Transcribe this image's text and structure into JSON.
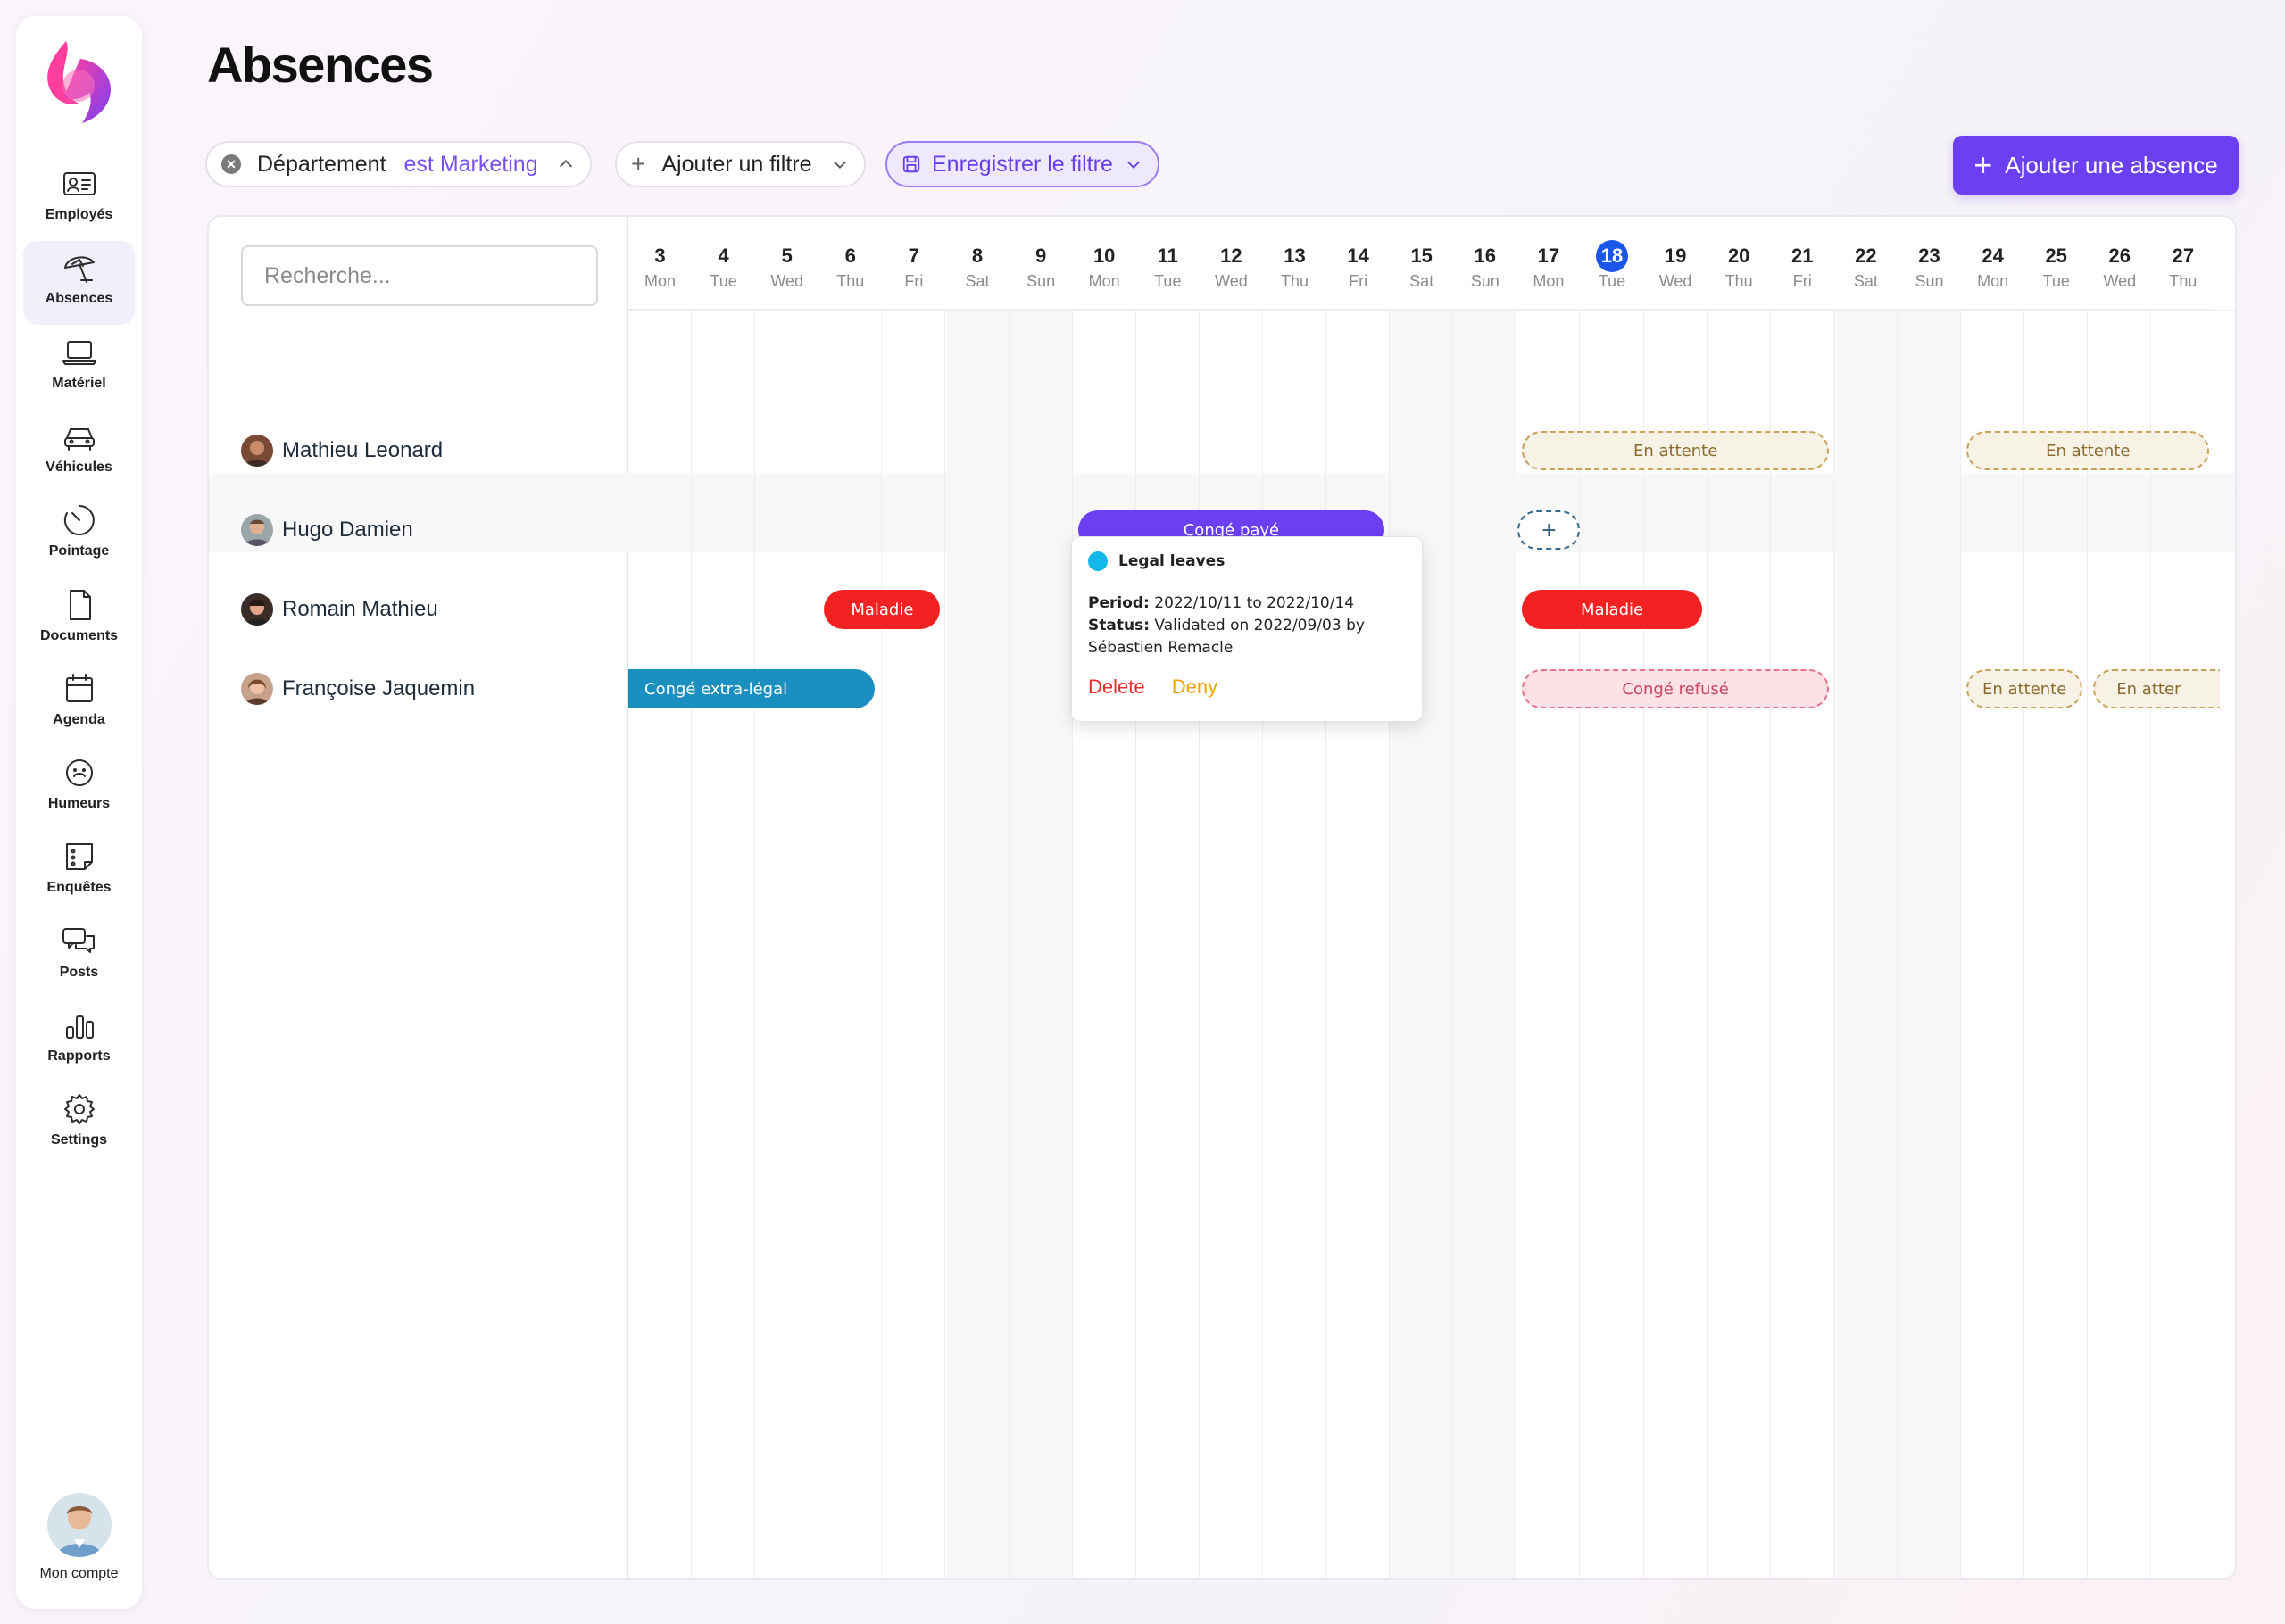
{
  "page": {
    "title": "Absences"
  },
  "sidebar": {
    "items": [
      {
        "id": "employes",
        "label": "Employés",
        "icon": "id-card-icon"
      },
      {
        "id": "absences",
        "label": "Absences",
        "icon": "beach-umbrella-icon",
        "active": true
      },
      {
        "id": "materiel",
        "label": "Matériel",
        "icon": "laptop-icon"
      },
      {
        "id": "vehicules",
        "label": "Véhicules",
        "icon": "car-icon"
      },
      {
        "id": "pointage",
        "label": "Pointage",
        "icon": "timer-icon"
      },
      {
        "id": "documents",
        "label": "Documents",
        "icon": "document-icon"
      },
      {
        "id": "agenda",
        "label": "Agenda",
        "icon": "calendar-icon"
      },
      {
        "id": "humeurs",
        "label": "Humeurs",
        "icon": "smiley-icon"
      },
      {
        "id": "enquetes",
        "label": "Enquêtes",
        "icon": "survey-icon"
      },
      {
        "id": "posts",
        "label": "Posts",
        "icon": "chat-bubbles-icon"
      },
      {
        "id": "rapports",
        "label": "Rapports",
        "icon": "bar-chart-icon"
      },
      {
        "id": "settings",
        "label": "Settings",
        "icon": "gear-icon"
      }
    ],
    "account_label": "Mon compte"
  },
  "filters": {
    "department_label": "Département",
    "department_value": "est Marketing",
    "add_filter_label": "Ajouter un filtre",
    "save_filter_label": "Enregistrer le filtre"
  },
  "add_absence_label": "Ajouter une absence",
  "search": {
    "placeholder": "Recherche..."
  },
  "days": [
    {
      "num": "3",
      "name": "Mon"
    },
    {
      "num": "4",
      "name": "Tue"
    },
    {
      "num": "5",
      "name": "Wed"
    },
    {
      "num": "6",
      "name": "Thu"
    },
    {
      "num": "7",
      "name": "Fri"
    },
    {
      "num": "8",
      "name": "Sat"
    },
    {
      "num": "9",
      "name": "Sun"
    },
    {
      "num": "10",
      "name": "Mon"
    },
    {
      "num": "11",
      "name": "Tue"
    },
    {
      "num": "12",
      "name": "Wed"
    },
    {
      "num": "13",
      "name": "Thu"
    },
    {
      "num": "14",
      "name": "Fri"
    },
    {
      "num": "15",
      "name": "Sat"
    },
    {
      "num": "16",
      "name": "Sun"
    },
    {
      "num": "17",
      "name": "Mon"
    },
    {
      "num": "18",
      "name": "Tue",
      "today": true
    },
    {
      "num": "19",
      "name": "Wed"
    },
    {
      "num": "20",
      "name": "Thu"
    },
    {
      "num": "21",
      "name": "Fri"
    },
    {
      "num": "22",
      "name": "Sat"
    },
    {
      "num": "23",
      "name": "Sun"
    },
    {
      "num": "24",
      "name": "Mon"
    },
    {
      "num": "25",
      "name": "Tue"
    },
    {
      "num": "26",
      "name": "Wed"
    },
    {
      "num": "27",
      "name": "Thu"
    }
  ],
  "employees": [
    {
      "name": "Mathieu Leonard"
    },
    {
      "name": "Hugo Damien"
    },
    {
      "name": "Romain Mathieu"
    },
    {
      "name": "Françoise Jaquemin"
    }
  ],
  "absences": [
    {
      "row": 0,
      "start_day": "17",
      "end_day": "21",
      "label": "En attente",
      "kind": "pending"
    },
    {
      "row": 0,
      "start_day": "24",
      "end_day": "27",
      "label": "En attente",
      "kind": "pending"
    },
    {
      "row": 1,
      "start_day": "10",
      "end_day": "14",
      "label": "Congé payé",
      "kind": "paid"
    },
    {
      "row": 1,
      "start_day": "17",
      "end_day": "17",
      "label": "+",
      "kind": "add"
    },
    {
      "row": 2,
      "start_day": "6",
      "end_day": "7",
      "label": "Maladie",
      "kind": "sick"
    },
    {
      "row": 2,
      "start_day": "17",
      "end_day": "19",
      "label": "Maladie",
      "kind": "sick"
    },
    {
      "row": 3,
      "start_day": "3",
      "end_day": "6",
      "label": "Congé extra-légal",
      "kind": "extra"
    },
    {
      "row": 3,
      "start_day": "17",
      "end_day": "21",
      "label": "Congé refusé",
      "kind": "refused"
    },
    {
      "row": 3,
      "start_day": "24",
      "end_day": "25",
      "label": "En attente",
      "kind": "pending"
    },
    {
      "row": 3,
      "start_day": "26",
      "end_day": "27",
      "label": "En atter",
      "kind": "pending",
      "cut": true
    }
  ],
  "popover": {
    "title": "Legal leaves",
    "period_label": "Period:",
    "period_value": " 2022/10/11 to 2022/10/14",
    "status_label": "Status:",
    "status_value": " Validated on 2022/09/03 by",
    "status_value_2": "Sébastien Remacle",
    "delete_label": "Delete",
    "deny_label": "Deny"
  }
}
